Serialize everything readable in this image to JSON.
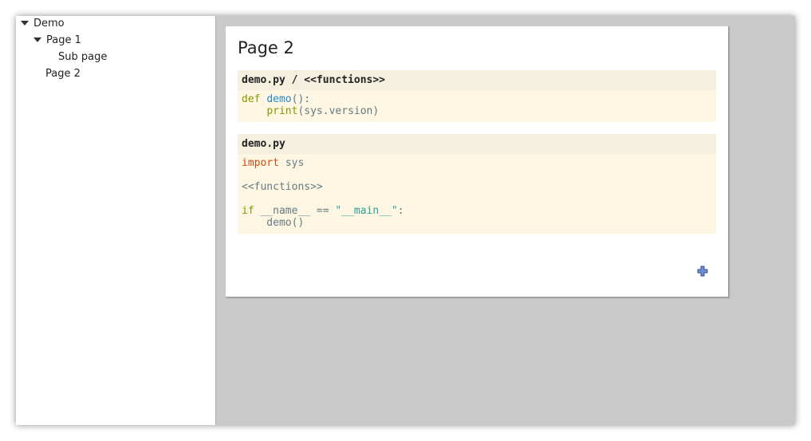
{
  "sidebar": {
    "items": [
      {
        "label": "Demo"
      },
      {
        "label": "Page 1"
      },
      {
        "label": "Sub page"
      },
      {
        "label": "Page 2"
      }
    ]
  },
  "page": {
    "title": "Page 2",
    "blocks": [
      {
        "header": "demo.py / <<functions>>",
        "lines": [
          {
            "tokens": [
              "def",
              " ",
              "demo",
              "():"
            ]
          },
          {
            "tokens": [
              "    ",
              "print",
              "(sys.version)"
            ]
          }
        ]
      },
      {
        "header": "demo.py",
        "lines": [
          {
            "tokens": [
              "import",
              " sys"
            ]
          },
          {
            "tokens": [
              ""
            ]
          },
          {
            "tokens": [
              "<<functions>>"
            ]
          },
          {
            "tokens": [
              ""
            ]
          },
          {
            "tokens": [
              "if",
              " __name__ == ",
              "\"__main__\"",
              ":"
            ]
          },
          {
            "tokens": [
              "    demo()"
            ]
          }
        ]
      }
    ],
    "add_icon": "plus-icon"
  },
  "colors": {
    "code_bg": "#fdf6e3",
    "header_bg": "#f5efdf",
    "keyword": "#859900",
    "import_keyword": "#cb4b16",
    "function": "#268bd2",
    "string": "#2aa198",
    "plain": "#657b83",
    "canvas_bg": "#c9c9c9",
    "add_icon": "#3a5fa8"
  }
}
